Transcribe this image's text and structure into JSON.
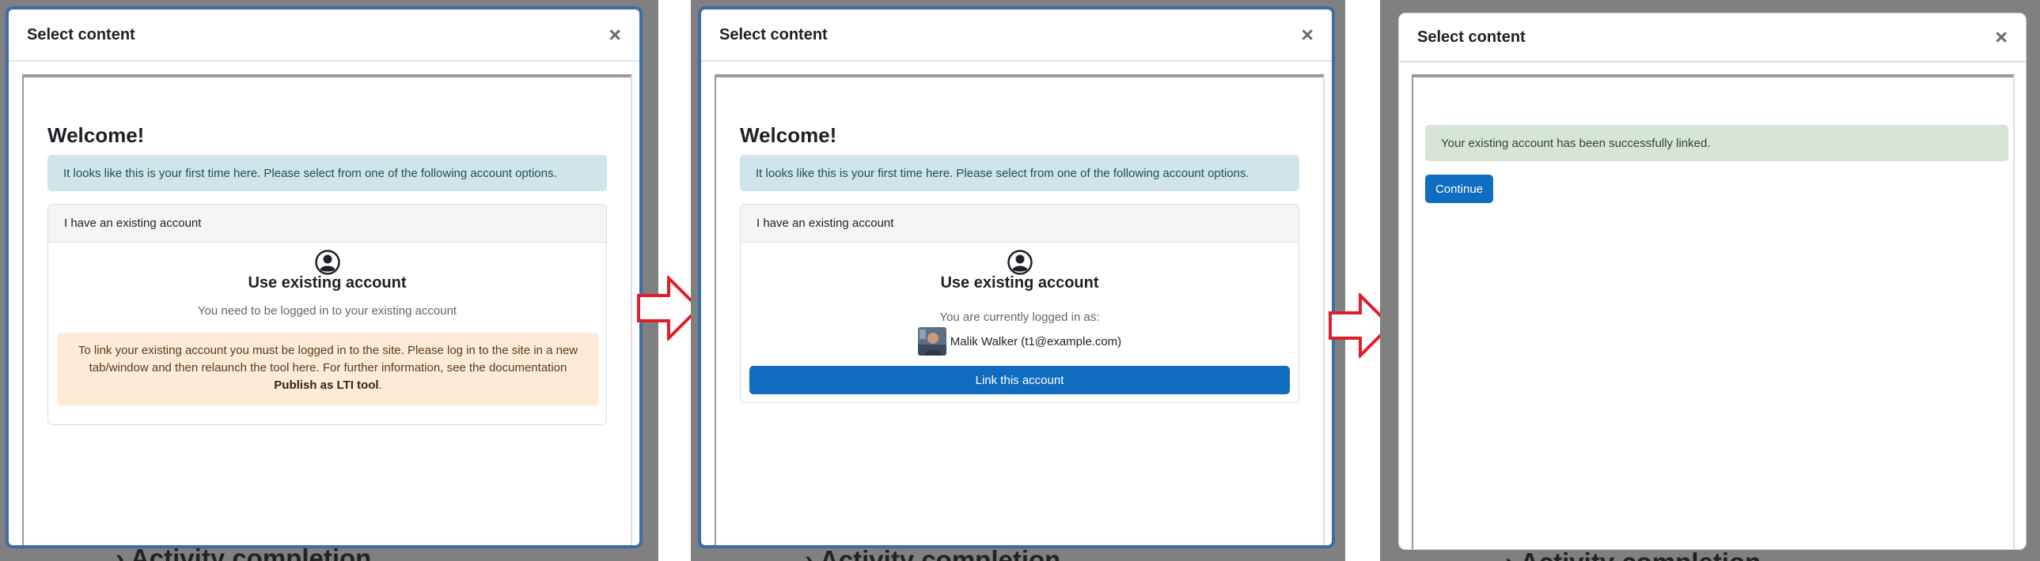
{
  "background": {
    "heading": "Activity completion",
    "heading_prefix": "›"
  },
  "colors": {
    "accent": "#0f6cbf",
    "focus_border": "#3a6ea5",
    "info_bg": "#cfe5ea",
    "warning_bg": "#fdebd8",
    "success_bg": "#d7e5d6",
    "arrow": "#e01e2b",
    "backdrop": "#808080"
  },
  "icons": {
    "close": "close-icon",
    "user": "user-circle-icon",
    "arrow": "right-arrow-icon"
  },
  "panel1": {
    "modal_title": "Select content",
    "close_label": "×",
    "welcome": "Welcome!",
    "info_text": "It looks like this is your first time here. Please select from one of the following account options.",
    "card_header": "I have an existing account",
    "card_title": "Use existing account",
    "login_required": "You need to be logged in to your existing account",
    "warning_text": "To link your existing account you must be logged in to the site. Please log in to the site in a new tab/window and then relaunch the tool here. For further information, see the documentation",
    "warning_link": "Publish as LTI tool",
    "warning_end": "."
  },
  "panel2": {
    "modal_title": "Select content",
    "close_label": "×",
    "welcome": "Welcome!",
    "info_text": "It looks like this is your first time here. Please select from one of the following account options.",
    "card_header": "I have an existing account",
    "card_title": "Use existing account",
    "logged_in_as": "You are currently logged in as:",
    "user_name": "Malik Walker (t1@example.com)",
    "link_button": "Link this account"
  },
  "panel3": {
    "modal_title": "Select content",
    "close_label": "×",
    "success_text": "Your existing account has been successfully linked.",
    "continue_button": "Continue"
  }
}
